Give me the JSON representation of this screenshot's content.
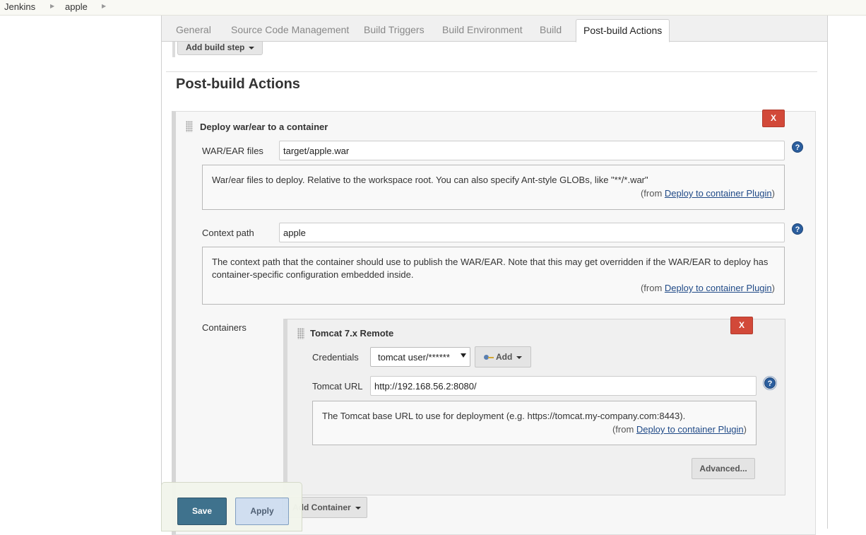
{
  "breadcrumb": {
    "items": [
      "Jenkins",
      "apple"
    ]
  },
  "tabs": [
    {
      "label": "General",
      "active": false
    },
    {
      "label": "Source Code Management",
      "active": false
    },
    {
      "label": "Build Triggers",
      "active": false
    },
    {
      "label": "Build Environment",
      "active": false
    },
    {
      "label": "Build",
      "active": false
    },
    {
      "label": "Post-build Actions",
      "active": true
    }
  ],
  "build": {
    "add_step_label": "Add build step"
  },
  "post_build": {
    "section_title": "Post-build Actions",
    "deploy": {
      "title": "Deploy war/ear to a container",
      "delete_label": "X",
      "war_label": "WAR/EAR files",
      "war_value": "target/apple.war",
      "war_help": "War/ear files to deploy. Relative to the workspace root. You can also specify Ant-style GLOBs, like \"**/*.war\"",
      "context_label": "Context path",
      "context_value": "apple",
      "context_help": "The context path that the container should use to publish the WAR/EAR. Note that this may get overridden if the WAR/EAR to deploy has container-specific configuration embedded inside.",
      "help_from_prefix": "(from ",
      "help_from_link": "Deploy to container Plugin",
      "help_from_suffix": ")",
      "containers_label": "Containers",
      "add_container_label": "Add Container"
    },
    "tomcat": {
      "title": "Tomcat 7.x Remote",
      "delete_label": "X",
      "credentials_label": "Credentials",
      "credentials_value": "tomcat  user/******",
      "add_label": "Add",
      "url_label": "Tomcat URL",
      "url_value": "http://192.168.56.2:8080/",
      "url_help": "The Tomcat base URL to use for deployment (e.g. https://tomcat.my-company.com:8443).",
      "advanced_label": "Advanced..."
    }
  },
  "footer": {
    "save_label": "Save",
    "apply_label": "Apply"
  },
  "help_icon_glyph": "?",
  "colors": {
    "delete": "#d24939",
    "save": "#3a6e8a",
    "apply": "#cfdef0",
    "help_icon": "#2b5e9e",
    "link": "#204a87"
  }
}
